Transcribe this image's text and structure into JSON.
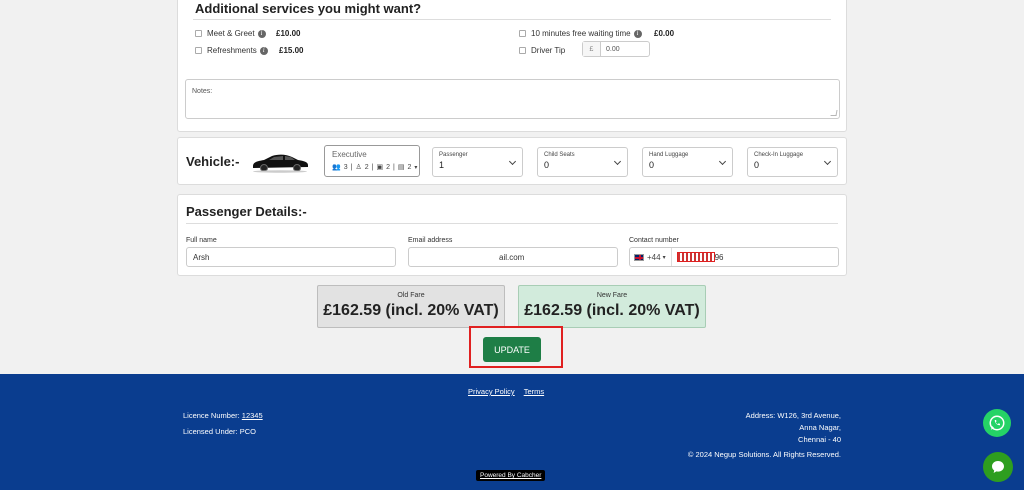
{
  "services": {
    "title": "Additional services you might want?",
    "items": [
      {
        "label": "Meet & Greet",
        "price": "£10.00"
      },
      {
        "label": "Refreshments",
        "price": "£15.00"
      },
      {
        "label": "10 minutes free waiting time",
        "price": "£0.00"
      },
      {
        "label": "Driver Tip",
        "currency": "£",
        "value": "0.00"
      }
    ],
    "notes_label": "Notes:"
  },
  "vehicle": {
    "title": "Vehicle:-",
    "selected": {
      "name": "Executive",
      "passengers": "3",
      "child_seats": "2",
      "hand_luggage": "2",
      "checkin_luggage": "2"
    },
    "selects": [
      {
        "label": "Passenger",
        "value": "1"
      },
      {
        "label": "Child Seats",
        "value": "0"
      },
      {
        "label": "Hand Luggage",
        "value": "0"
      },
      {
        "label": "Check-In Luggage",
        "value": "0"
      }
    ]
  },
  "passenger": {
    "title": "Passenger Details:-",
    "full_name_label": "Full name",
    "full_name": "Arsh",
    "email_label": "Email address",
    "email": "ail.com",
    "contact_label": "Contact number",
    "country_code": "+44",
    "phone_suffix": "96"
  },
  "fares": {
    "old_label": "Old Fare",
    "old_value": "£162.59 (incl. 20% VAT)",
    "new_label": "New Fare",
    "new_value": "£162.59 (incl. 20% VAT)"
  },
  "update_label": "UPDATE",
  "footer": {
    "privacy": "Privacy Policy",
    "terms": "Terms",
    "licence_label": "Licence Number:",
    "licence_number": "12345",
    "licensed_under": "Licensed Under: PCO",
    "address_1": "Address: W126, 3rd Avenue,",
    "address_2": "Anna Nagar,",
    "address_3": "Chennai - 40",
    "copyright": "© 2024  Negup Solutions. All Rights Reserved.",
    "powered": "Powered By Cabcher"
  },
  "colors": {
    "accent": "#1e7e46",
    "footer": "#0a3d8f",
    "highlight": "#e02020",
    "whatsapp": "#25d366"
  }
}
